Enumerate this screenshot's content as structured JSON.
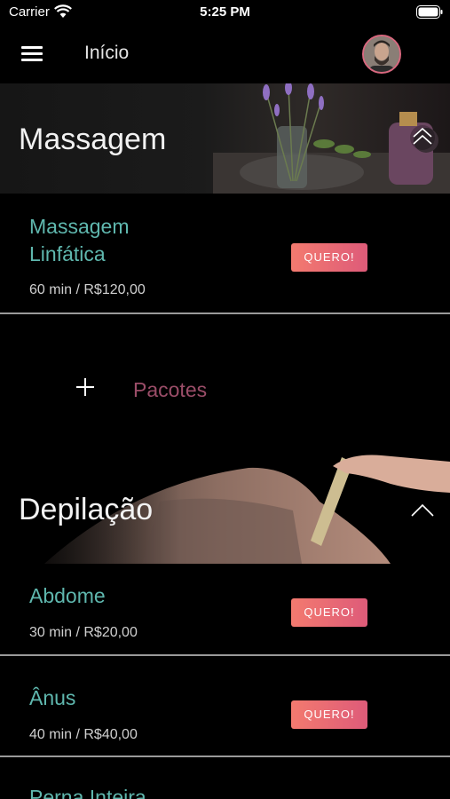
{
  "status_bar": {
    "carrier": "Carrier",
    "time": "5:25 PM"
  },
  "nav": {
    "title": "Início",
    "menu_icon": "hamburger-menu-icon",
    "avatar_icon": "user-avatar"
  },
  "categories": [
    {
      "title": "Massagem",
      "services": [
        {
          "name_line1": "Massagem",
          "name_line2": "Linfática",
          "meta": "60 min / R$120,00",
          "button": "QUERO!"
        }
      ]
    },
    {
      "title": "Depilação",
      "services": [
        {
          "name": "Abdome",
          "meta": "30 min / R$20,00",
          "button": "QUERO!"
        },
        {
          "name": "Ânus",
          "meta": "40 min / R$40,00",
          "button": "QUERO!"
        },
        {
          "name": "Perna Inteira"
        }
      ]
    }
  ],
  "pacotes": {
    "label": "Pacotes",
    "icon": "plus-icon"
  },
  "colors": {
    "accent_teal": "#5fb7ae",
    "button_gradient_start": "#f37a6f",
    "button_gradient_end": "#de5b79",
    "pacotes_color": "#9b4d68",
    "avatar_border": "#d9687f"
  }
}
